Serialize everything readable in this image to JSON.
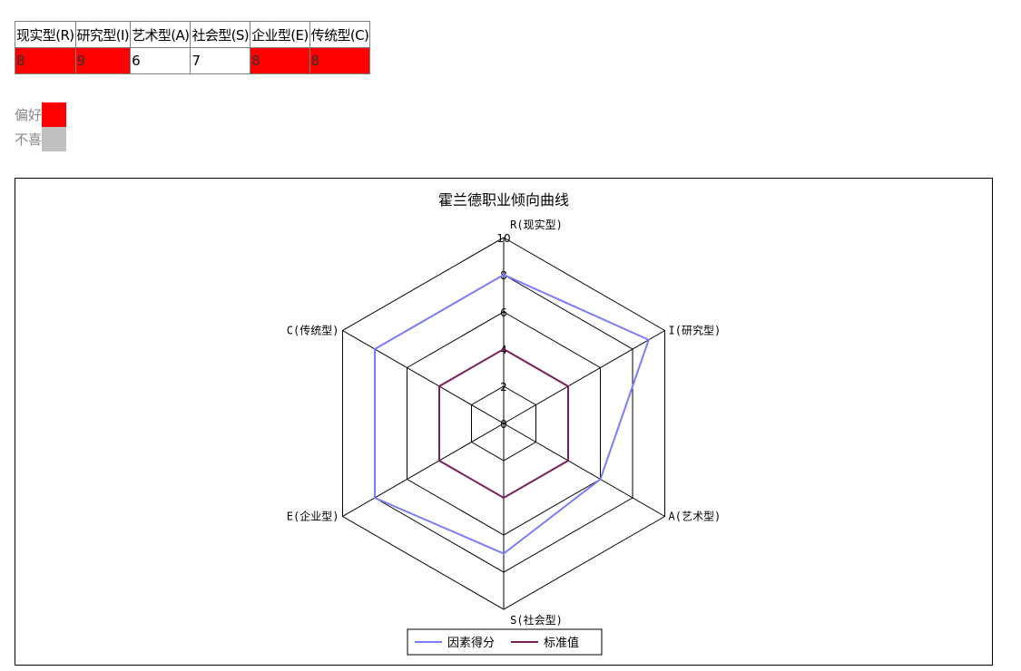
{
  "table": {
    "headers": [
      "现实型(R)",
      "研究型(I)",
      "艺术型(A)",
      "社会型(S)",
      "企业型(E)",
      "传统型(C)"
    ],
    "values": [
      "8",
      "9",
      "6",
      "7",
      "8",
      "8"
    ],
    "highlight": [
      true,
      true,
      false,
      false,
      true,
      true
    ]
  },
  "legend": {
    "items": [
      {
        "label": "偏好",
        "color": "#ff0000"
      },
      {
        "label": "不喜",
        "color": "#c0c0c0"
      }
    ]
  },
  "colors": {
    "highlight": "#ff0000",
    "series_score": "#7b7bff",
    "series_standard": "#7a1f5c",
    "grid": "#000000"
  },
  "chart_data": {
    "type": "radar",
    "title": "霍兰德职业倾向曲线",
    "axes": [
      "R(现实型)",
      "I(研究型)",
      "A(艺术型)",
      "S(社会型)",
      "E(企业型)",
      "C(传统型)"
    ],
    "range": [
      0,
      10
    ],
    "ticks": [
      "0",
      "2",
      "4",
      "6",
      "8",
      "10"
    ],
    "series": [
      {
        "name": "因素得分",
        "values": [
          8,
          9,
          6,
          7,
          8,
          8
        ]
      },
      {
        "name": "标准值",
        "values": [
          4,
          4,
          4,
          4,
          4,
          4
        ]
      }
    ],
    "legend_position": "bottom"
  }
}
